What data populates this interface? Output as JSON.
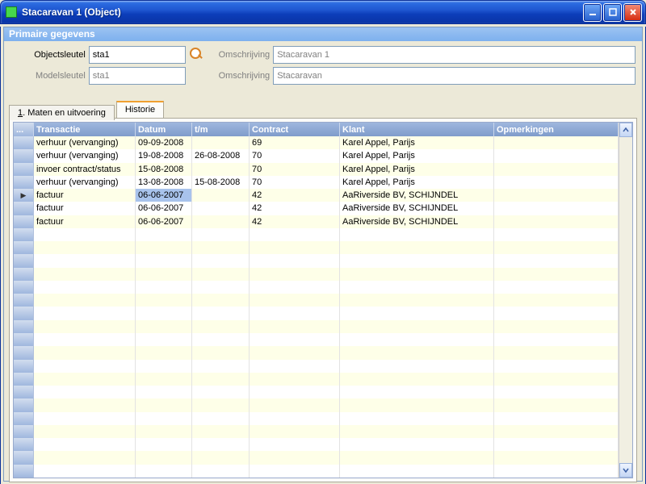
{
  "window": {
    "title": "Stacaravan 1 (Object)"
  },
  "group": {
    "title": "Primaire gegevens"
  },
  "form": {
    "objectsleutel_label": "Objectsleutel",
    "objectsleutel_value": "sta1",
    "omschrijving1_label": "Omschrijving",
    "omschrijving1_value": "Stacaravan 1",
    "modelsleutel_label": "Modelsleutel",
    "modelsleutel_value": "sta1",
    "omschrijving2_label": "Omschrijving",
    "omschrijving2_value": "Stacaravan"
  },
  "tabs": {
    "tab1_pre": "1",
    "tab1_rest": ". Maten en uitvoering",
    "tab2": "Historie"
  },
  "grid": {
    "indicator_header": "...",
    "cols": {
      "transactie": "Transactie",
      "datum": "Datum",
      "tm": "t/m",
      "contract": "Contract",
      "klant": "Klant",
      "opmerkingen": "Opmerkingen"
    },
    "rows": [
      {
        "transactie": "verhuur (vervanging)",
        "datum": "09-09-2008",
        "tm": "",
        "contract": "69",
        "klant": "Karel Appel, Parijs",
        "opm": "",
        "sel": false
      },
      {
        "transactie": "verhuur (vervanging)",
        "datum": "19-08-2008",
        "tm": "26-08-2008",
        "contract": "70",
        "klant": "Karel Appel, Parijs",
        "opm": "",
        "sel": false
      },
      {
        "transactie": "invoer contract/status",
        "datum": "15-08-2008",
        "tm": "",
        "contract": "70",
        "klant": "Karel Appel, Parijs",
        "opm": "",
        "sel": false
      },
      {
        "transactie": "verhuur (vervanging)",
        "datum": "13-08-2008",
        "tm": "15-08-2008",
        "contract": "70",
        "klant": "Karel Appel, Parijs",
        "opm": "",
        "sel": false
      },
      {
        "transactie": "factuur",
        "datum": "06-06-2007",
        "tm": "",
        "contract": "42",
        "klant": "AaRiverside BV, SCHIJNDEL",
        "opm": "",
        "sel": true
      },
      {
        "transactie": "factuur",
        "datum": "06-06-2007",
        "tm": "",
        "contract": "42",
        "klant": "AaRiverside BV, SCHIJNDEL",
        "opm": "",
        "sel": false
      },
      {
        "transactie": "factuur",
        "datum": "06-06-2007",
        "tm": "",
        "contract": "42",
        "klant": "AaRiverside BV, SCHIJNDEL",
        "opm": "",
        "sel": false
      }
    ],
    "empty_rows": 19
  }
}
